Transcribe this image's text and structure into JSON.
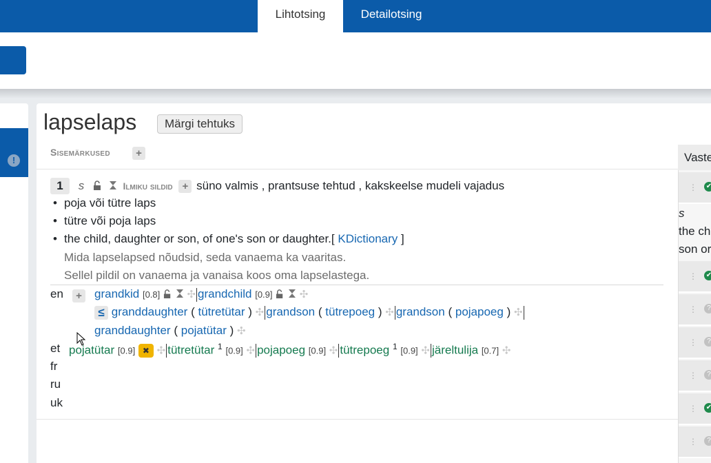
{
  "tabs": {
    "simple": "Lihtotsing",
    "detail": "Detailotsing"
  },
  "word": {
    "title": "lapselaps",
    "mark_done": "Märgi tehtuks"
  },
  "notes_label": "Sisemärkused",
  "meaning": {
    "number": "1",
    "register": "s",
    "tags_label": "Ilmiku sildid",
    "tags_text": "süno valmis , prantsuse tehtud , kakskeelse mudeli vajadus",
    "definitions": [
      "poja või tütre laps",
      "tütre või poja laps",
      "the child, daughter or son, of one's son or daughter."
    ],
    "source_open": "[",
    "source": "KDictionary",
    "source_close": "]",
    "examples": [
      "Mida lapselapsed nõudsid, seda vanaema ka vaaritas.",
      "Sellel pildil on vanaema ja vanaisa koos oma lapselastega."
    ]
  },
  "translations": {
    "en_label": "en",
    "et_label": "et",
    "fr_label": "fr",
    "ru_label": "ru",
    "uk_label": "uk",
    "en": {
      "grandkid": "grandkid",
      "grandkid_w": "[0.8]",
      "grandchild": "grandchild",
      "grandchild_w": "[0.9]",
      "le": "≤",
      "granddaughter1": "granddaughter",
      "granddaughter1_p": "tütretütar",
      "grandson": "grandson",
      "grandson_p": "tütrepoeg",
      "grandson2": "grandson",
      "grandson2_p": "pojapoeg",
      "granddaughter2": "granddaughter",
      "granddaughter2_p": "pojatütar",
      "po": "(",
      "pc": ")"
    },
    "et": {
      "w1": "pojatütar",
      "w1_w": "[0.9]",
      "w2": "tütretütar",
      "w2_sup": "1",
      "w2_w": "[0.9]",
      "w3": "pojapoeg",
      "w3_w": "[0.9]",
      "w4": "tütrepoeg",
      "w4_sup": "1",
      "w4_w": "[0.9]",
      "w5": "järeltulija",
      "w5_w": "[0.7]"
    }
  },
  "right_panel": {
    "header": "Vaste",
    "text1": "s",
    "text2": "the ch",
    "text3": "son or"
  },
  "icons": [
    "plus-icon",
    "unlock-icon",
    "hourglass-icon",
    "move-icon",
    "check-circle-icon",
    "question-circle-icon",
    "drag-icon",
    "warning-icon",
    "close-icon",
    "cursor-icon"
  ]
}
